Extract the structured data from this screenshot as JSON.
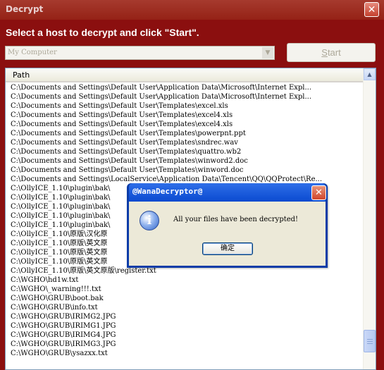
{
  "window": {
    "title": "Decrypt",
    "close_label": "✕",
    "instruction": "Select a host to decrypt and click \"Start\".",
    "host_select_value": "My Computer",
    "start_label_pre": "",
    "start_label_accel": "S",
    "start_label_post": "tart"
  },
  "list": {
    "header": "Path",
    "rows": [
      "C:\\Documents and Settings\\Default User\\Application Data\\Microsoft\\Internet Expl...",
      "C:\\Documents and Settings\\Default User\\Application Data\\Microsoft\\Internet Expl...",
      "C:\\Documents and Settings\\Default User\\Templates\\excel.xls",
      "C:\\Documents and Settings\\Default User\\Templates\\excel4.xls",
      "C:\\Documents and Settings\\Default User\\Templates\\excel4.xls",
      "C:\\Documents and Settings\\Default User\\Templates\\powerpnt.ppt",
      "C:\\Documents and Settings\\Default User\\Templates\\sndrec.wav",
      "C:\\Documents and Settings\\Default User\\Templates\\quattro.wb2",
      "C:\\Documents and Settings\\Default User\\Templates\\winword2.doc",
      "C:\\Documents and Settings\\Default User\\Templates\\winword.doc",
      "C:\\Documents and Settings\\LocalService\\Application Data\\Tencent\\QQ\\QQProtect\\Re...",
      "C:\\OllyICE_1.10\\plugin\\bak\\",
      "C:\\OllyICE_1.10\\plugin\\bak\\",
      "C:\\OllyICE_1.10\\plugin\\bak\\",
      "C:\\OllyICE_1.10\\plugin\\bak\\",
      "C:\\OllyICE_1.10\\plugin\\bak\\",
      "C:\\OllyICE_1.10\\原版\\汉化原",
      "C:\\OllyICE_1.10\\原版\\英文原",
      "C:\\OllyICE_1.10\\原版\\英文原",
      "C:\\OllyICE_1.10\\原版\\英文原",
      "C:\\OllyICE_1.10\\原版\\英文原版\\register.txt",
      "C:\\WGHO\\hd1w.txt",
      "C:\\WGHO\\_warning!!!.txt",
      "C:\\WGHO\\GRUB\\boot.bak",
      "C:\\WGHO\\GRUB\\info.txt",
      "C:\\WGHO\\GRUB\\IRIMG2.JPG",
      "C:\\WGHO\\GRUB\\IRIMG1.JPG",
      "C:\\WGHO\\GRUB\\IRIMG4.JPG",
      "C:\\WGHO\\GRUB\\IRIMG3.JPG",
      "C:\\WGHO\\GRUB\\ysazxx.txt"
    ],
    "scroll_up": "▲"
  },
  "dialog": {
    "title": "@WanaDecryptor@",
    "close_label": "✕",
    "icon_glyph": "i",
    "message": "All your files have been decrypted!",
    "ok_label": "确定"
  },
  "colors": {
    "window_bg": "#8b0f0f",
    "dialog_frame": "#0a3ca8"
  }
}
